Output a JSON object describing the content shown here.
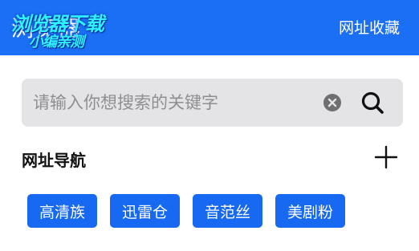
{
  "header": {
    "title": "浏览器",
    "bookmarks_label": "网址收藏",
    "background_color": "#1a6ff5"
  },
  "watermark": {
    "line1": "浏览器下载",
    "line2": "小编亲测"
  },
  "search": {
    "placeholder": "请输入你想搜索的关键字",
    "value": "",
    "clear_icon": "clear-circle-icon",
    "search_icon": "magnifier-icon"
  },
  "nav_section": {
    "title": "网址导航",
    "add_icon": "plus-icon",
    "links": [
      {
        "label": "高清族"
      },
      {
        "label": "迅雷仓"
      },
      {
        "label": "音范丝"
      },
      {
        "label": "美剧粉"
      }
    ],
    "chip_color": "#1769f2"
  }
}
